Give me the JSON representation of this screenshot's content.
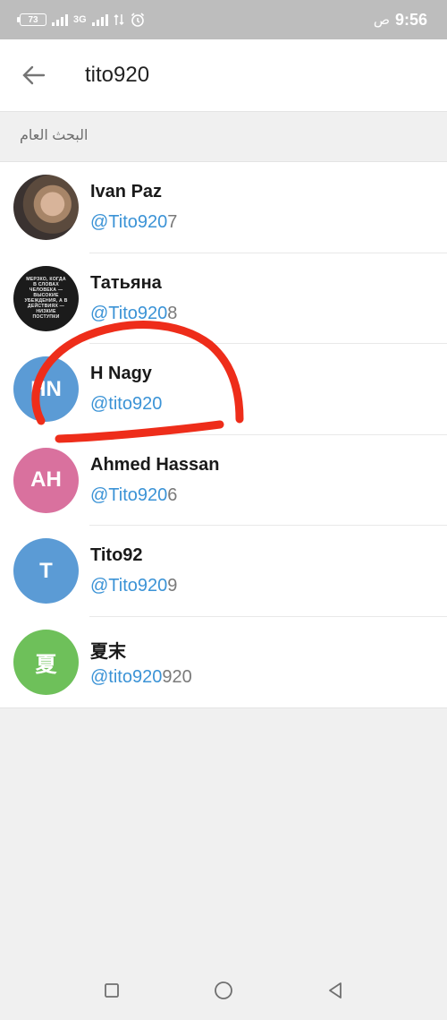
{
  "status_bar": {
    "battery": "73",
    "network": "3G",
    "time": "9:56",
    "time_suffix": "ص"
  },
  "header": {
    "search_query": "tito920"
  },
  "section": {
    "title": "البحث العام"
  },
  "results": [
    {
      "name": "Ivan Paz",
      "username_match": "@Tito920",
      "username_rest": "7",
      "avatar_type": "photo"
    },
    {
      "name": "Татьяна",
      "username_match": "@Tito920",
      "username_rest": "8",
      "avatar_type": "photo",
      "avatar_text": "МЕРЗКО, КОГДА В СЛОВАХ ЧЕЛОВЕКА — ВЫСОКИЕ УБЕЖДЕНИЯ, А В ДЕЙСТВИЯХ — НИЗКИЕ ПОСТУПКИ"
    },
    {
      "name": "H Nagy",
      "username_match": "@tito920",
      "username_rest": "",
      "avatar_initials": "HN",
      "avatar_color": "#5b9bd5"
    },
    {
      "name": "Ahmed Hassan",
      "username_match": "@Tito920",
      "username_rest": "6",
      "avatar_initials": "AH",
      "avatar_color": "#d9719e"
    },
    {
      "name": "Tito92",
      "username_match": "@Tito920",
      "username_rest": "9",
      "avatar_initials": "T",
      "avatar_color": "#5b9bd5"
    },
    {
      "name": "夏末",
      "username_match": "@tito920",
      "username_rest": "920",
      "avatar_initials": "夏",
      "avatar_color": "#6ec05a"
    }
  ],
  "colors": {
    "accent": "#3b93d6",
    "annotation": "#ee2d1a"
  },
  "icons": {
    "back": "arrow-left-icon",
    "alarm": "alarm-icon",
    "nav_recents": "square-icon",
    "nav_home": "circle-icon",
    "nav_back": "triangle-back-icon"
  }
}
